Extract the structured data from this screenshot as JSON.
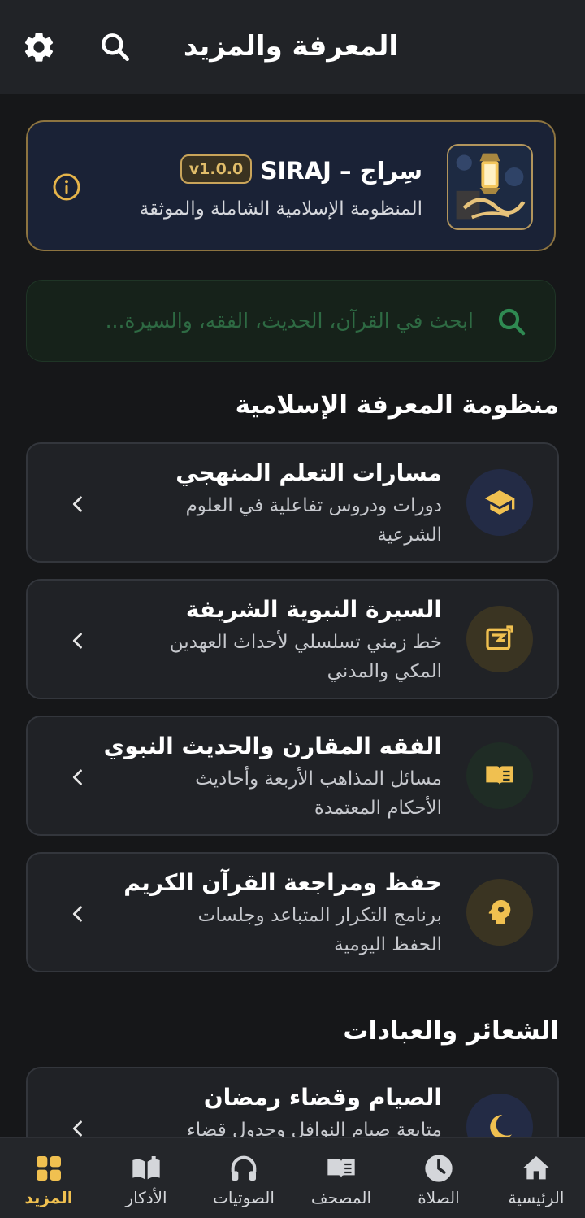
{
  "header": {
    "title": "المعرفة والمزيد",
    "search_icon": "search-icon",
    "settings_icon": "gear-icon"
  },
  "hero": {
    "logo_icon": "siraj-lantern-logo",
    "name": "سِراج – SIRAJ",
    "version": "v1.0.0",
    "tagline": "المنظومة الإسلامية الشاملة والموثقة",
    "info_icon": "info-icon"
  },
  "search": {
    "placeholder": "ابحث في القرآن، الحديث، الفقه، والسيرة..."
  },
  "sections": [
    {
      "title": "منظومة المعرفة الإسلامية",
      "cards": [
        {
          "title": "مسارات التعلم المنهجي",
          "desc": "دورات ودروس تفاعلية في العلوم الشرعية",
          "icon": "graduation-cap-icon"
        },
        {
          "title": "السيرة النبوية الشريفة",
          "desc": "خط زمني تسلسلي لأحداث العهدين المكي والمدني",
          "icon": "map-history-icon"
        },
        {
          "title": "الفقه المقارن والحديث النبوي",
          "desc": "مسائل المذاهب الأربعة وأحاديث الأحكام المعتمدة",
          "icon": "open-book-icon"
        },
        {
          "title": "حفظ ومراجعة القرآن الكريم",
          "desc": "برنامج التكرار المتباعد وجلسات الحفظ اليومية",
          "icon": "memory-head-icon"
        }
      ]
    },
    {
      "title": "الشعائر والعبادات",
      "cards": [
        {
          "title": "الصيام وقضاء رمضان",
          "desc": "متابعة صيام النوافل وجدول قضاء",
          "icon": "crescent-moon-icon"
        }
      ]
    }
  ],
  "colors": {
    "accent_gold": "#f0c050",
    "hero_border": "#8d7440",
    "search_green": "#2e6a43"
  },
  "bottom_nav": [
    {
      "label": "الرئيسية",
      "icon": "home-icon"
    },
    {
      "label": "الصلاة",
      "icon": "clock-icon"
    },
    {
      "label": "المصحف",
      "icon": "quran-book-icon"
    },
    {
      "label": "الصوتيات",
      "icon": "headphones-icon"
    },
    {
      "label": "الأذكار",
      "icon": "open-book-stand-icon"
    },
    {
      "label": "المزيد",
      "icon": "grid-icon",
      "active": true
    }
  ]
}
